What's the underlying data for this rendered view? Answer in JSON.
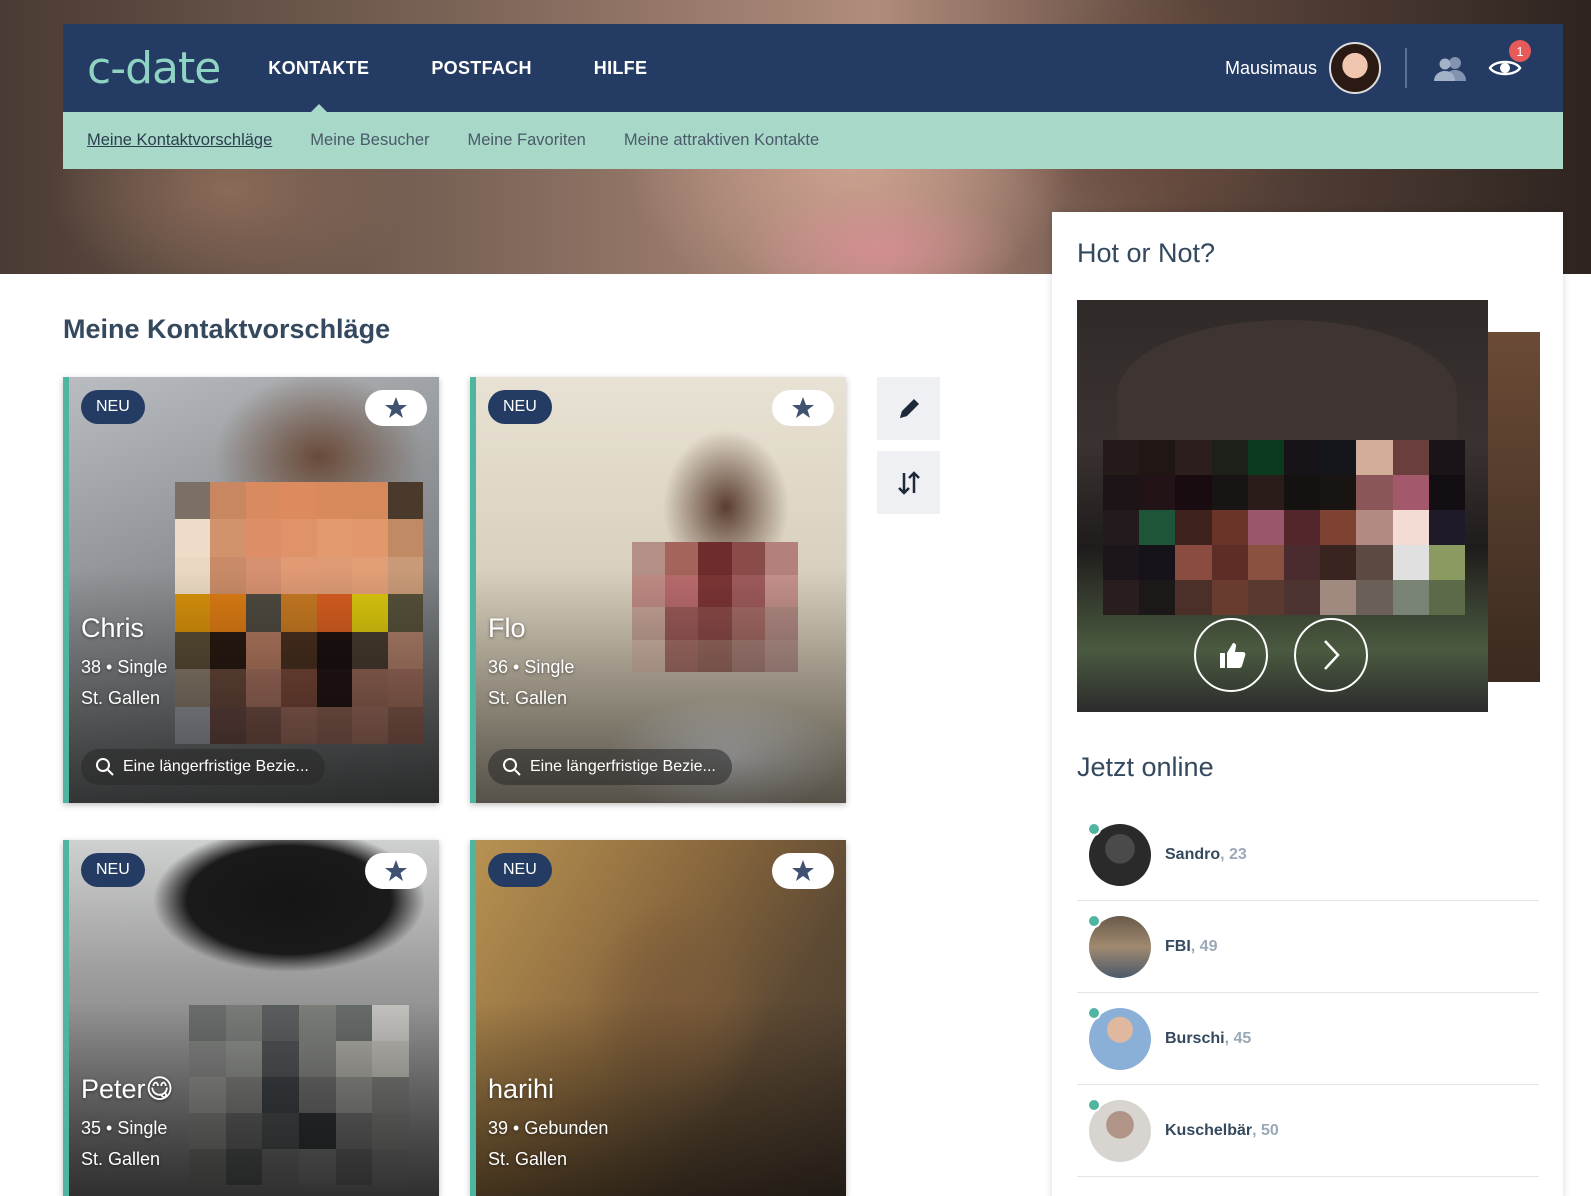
{
  "app": {
    "logo_text": "c-date"
  },
  "nav": {
    "items": [
      {
        "label": "KONTAKTE",
        "active": true
      },
      {
        "label": "POSTFACH",
        "active": false
      },
      {
        "label": "HILFE",
        "active": false
      }
    ],
    "username": "Mausimaus",
    "notification_count": "1"
  },
  "subnav": {
    "items": [
      {
        "label": "Meine Kontaktvorschläge",
        "active": true
      },
      {
        "label": "Meine Besucher",
        "active": false
      },
      {
        "label": "Meine Favoriten",
        "active": false
      },
      {
        "label": "Meine attraktiven Kontakte",
        "active": false
      }
    ]
  },
  "main": {
    "title": "Meine Kontaktvorschläge",
    "cards": [
      {
        "badge": "NEU",
        "name": "Chris",
        "meta": "38 • Single",
        "city": "St. Gallen",
        "search": "Eine längerfristige Bezie..."
      },
      {
        "badge": "NEU",
        "name": "Flo",
        "meta": "36 • Single",
        "city": "St. Gallen",
        "search": "Eine längerfristige Bezie..."
      },
      {
        "badge": "NEU",
        "name": "Peter😋",
        "meta": "35 • Single",
        "city": "St. Gallen"
      },
      {
        "badge": "NEU",
        "name": "harihi",
        "meta": "39 • Gebunden",
        "city": "St. Gallen"
      }
    ]
  },
  "side": {
    "hot_title": "Hot or Not?",
    "online_title": "Jetzt online",
    "online": [
      {
        "name": "Sandro",
        "age": ", 23"
      },
      {
        "name": "FBI",
        "age": ", 49"
      },
      {
        "name": "Burschi",
        "age": ", 45"
      },
      {
        "name": "Kuschelbär",
        "age": ", 50"
      }
    ]
  },
  "colors": {
    "navy": "#243b63",
    "mint": "#a8d8c8",
    "teal": "#4fb5a0",
    "badge_red": "#e65a5a"
  }
}
